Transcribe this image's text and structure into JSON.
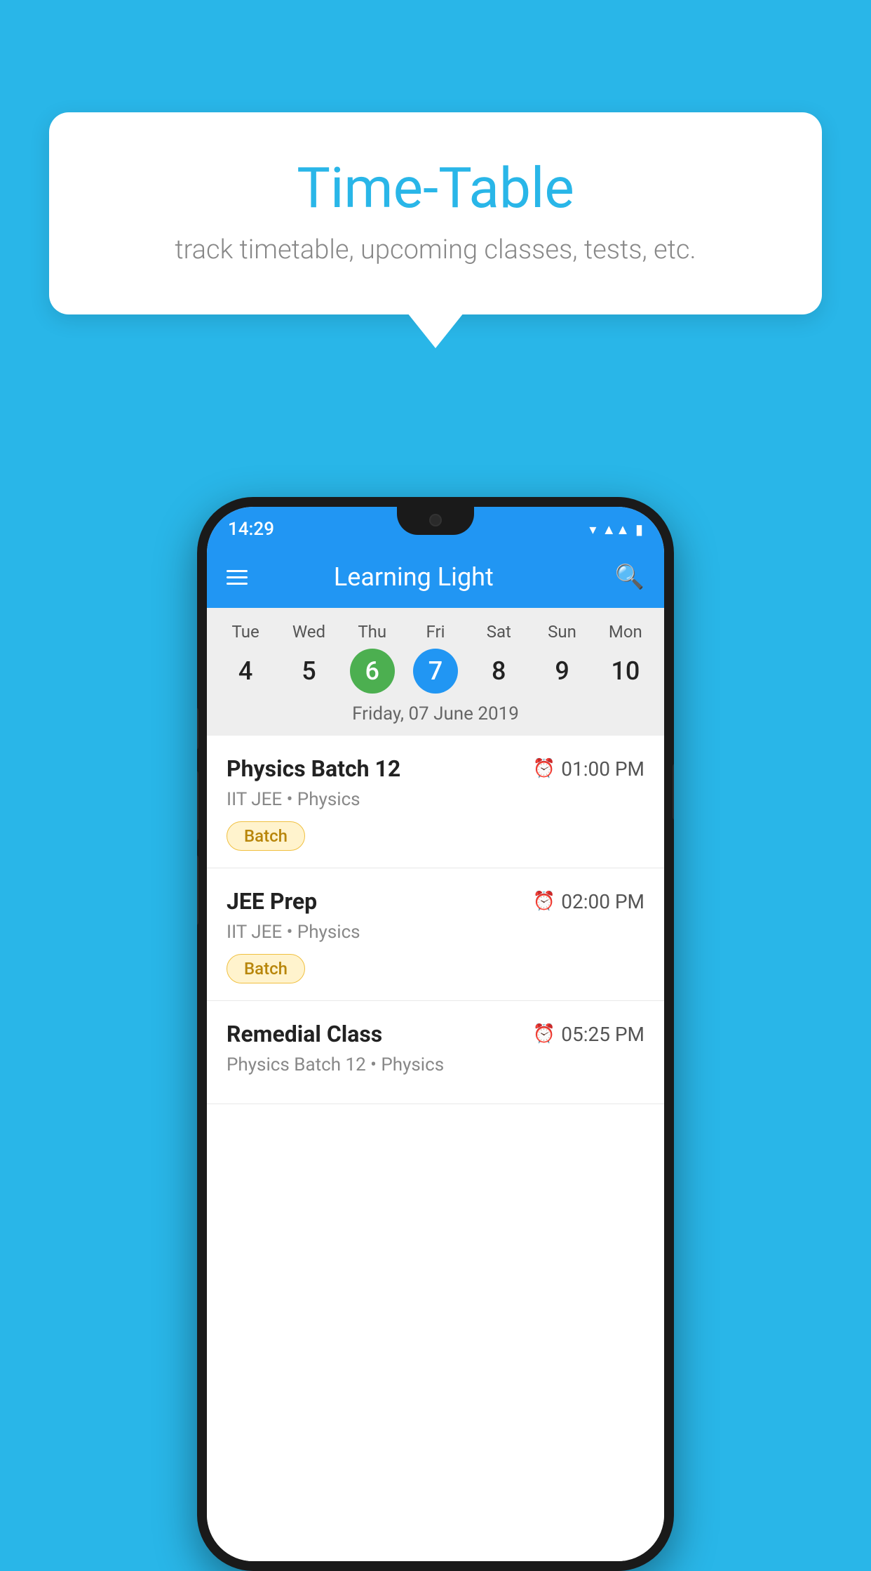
{
  "background_color": "#29b6e8",
  "tooltip": {
    "title": "Time-Table",
    "subtitle": "track timetable, upcoming classes, tests, etc."
  },
  "phone": {
    "status_bar": {
      "time": "14:29"
    },
    "app_bar": {
      "title": "Learning Light"
    },
    "calendar": {
      "days": [
        {
          "name": "Tue",
          "num": "4",
          "state": "normal"
        },
        {
          "name": "Wed",
          "num": "5",
          "state": "normal"
        },
        {
          "name": "Thu",
          "num": "6",
          "state": "today"
        },
        {
          "name": "Fri",
          "num": "7",
          "state": "selected"
        },
        {
          "name": "Sat",
          "num": "8",
          "state": "normal"
        },
        {
          "name": "Sun",
          "num": "9",
          "state": "normal"
        },
        {
          "name": "Mon",
          "num": "10",
          "state": "normal"
        }
      ],
      "selected_date_label": "Friday, 07 June 2019"
    },
    "schedule": {
      "items": [
        {
          "title": "Physics Batch 12",
          "time": "01:00 PM",
          "meta": "IIT JEE • Physics",
          "tag": "Batch"
        },
        {
          "title": "JEE Prep",
          "time": "02:00 PM",
          "meta": "IIT JEE • Physics",
          "tag": "Batch"
        },
        {
          "title": "Remedial Class",
          "time": "05:25 PM",
          "meta": "Physics Batch 12 • Physics",
          "tag": ""
        }
      ]
    }
  }
}
